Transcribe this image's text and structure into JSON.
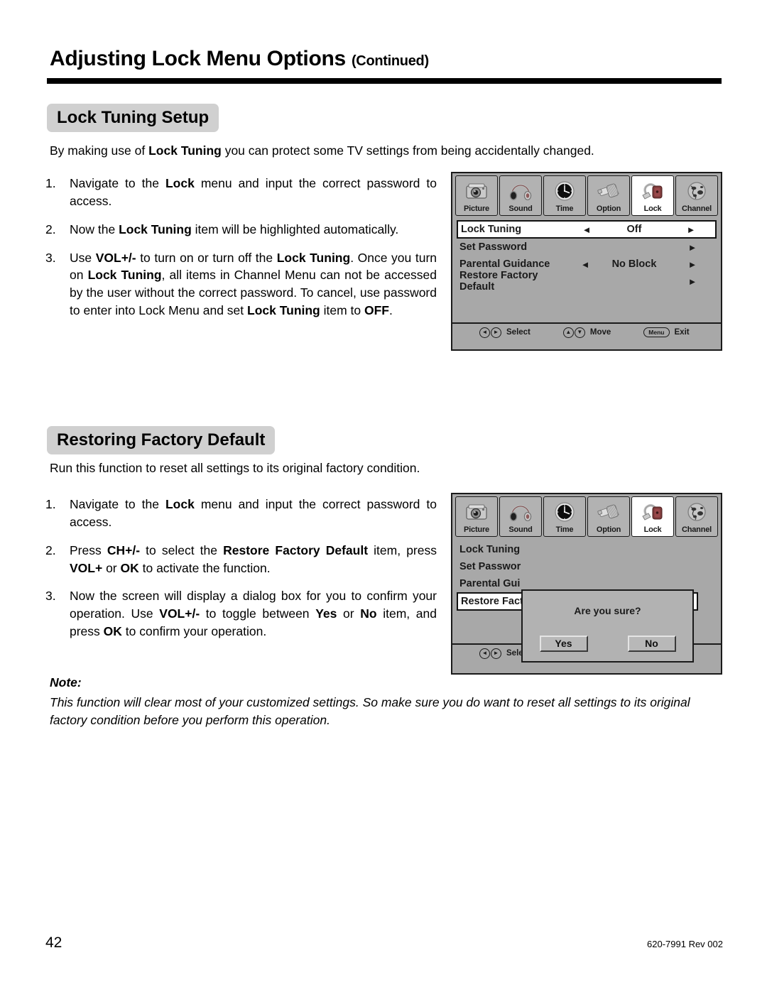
{
  "page": {
    "title_main": "Adjusting Lock Menu Options",
    "title_continued": "(Continued)",
    "folio": "42",
    "part_number": "620-7991 Rev 002"
  },
  "section_lock_tuning": {
    "heading": "Lock Tuning Setup",
    "intro_pre": "By making use of ",
    "intro_bold": "Lock Tuning",
    "intro_post": " you can protect some TV settings from being accidentally changed.",
    "steps": [
      {
        "num": "1.",
        "parts": [
          {
            "t": "Navigate to the ",
            "b": false
          },
          {
            "t": "Lock",
            "b": true
          },
          {
            "t": " menu and input the correct password to access.",
            "b": false
          }
        ]
      },
      {
        "num": "2.",
        "parts": [
          {
            "t": "Now the ",
            "b": false
          },
          {
            "t": "Lock Tuning",
            "b": true
          },
          {
            "t": " item will be highlighted automatically.",
            "b": false
          }
        ]
      },
      {
        "num": "3.",
        "parts": [
          {
            "t": "Use ",
            "b": false
          },
          {
            "t": "VOL+/-",
            "b": true
          },
          {
            "t": " to turn on or turn off the ",
            "b": false
          },
          {
            "t": "Lock Tuning",
            "b": true
          },
          {
            "t": ". Once you turn on ",
            "b": false
          },
          {
            "t": "Lock Tuning",
            "b": true
          },
          {
            "t": ", all items in Channel Menu can not be accessed by the user without the correct password. To cancel, use password to enter into Lock Menu and set ",
            "b": false
          },
          {
            "t": "Lock Tuning",
            "b": true
          },
          {
            "t": " item to ",
            "b": false
          },
          {
            "t": "OFF",
            "b": true
          },
          {
            "t": ".",
            "b": false
          }
        ]
      }
    ]
  },
  "section_restore": {
    "heading": "Restoring Factory Default",
    "intro": "Run this function to reset all settings to its original factory condition.",
    "steps": [
      {
        "num": "1.",
        "parts": [
          {
            "t": "Navigate to the ",
            "b": false
          },
          {
            "t": "Lock",
            "b": true
          },
          {
            "t": " menu and input the correct password to access.",
            "b": false
          }
        ]
      },
      {
        "num": "2.",
        "parts": [
          {
            "t": "Press ",
            "b": false
          },
          {
            "t": "CH+/-",
            "b": true
          },
          {
            "t": " to select the ",
            "b": false
          },
          {
            "t": "Restore Factory Default",
            "b": true
          },
          {
            "t": " item, press ",
            "b": false
          },
          {
            "t": "VOL+",
            "b": true
          },
          {
            "t": " or ",
            "b": false
          },
          {
            "t": "OK",
            "b": true
          },
          {
            "t": " to activate the function.",
            "b": false
          }
        ]
      },
      {
        "num": "3.",
        "parts": [
          {
            "t": "Now the screen will display a dialog box for you to confirm your operation. Use ",
            "b": false
          },
          {
            "t": "VOL+/-",
            "b": true
          },
          {
            "t": " to toggle between ",
            "b": false
          },
          {
            "t": "Yes",
            "b": true
          },
          {
            "t": " or ",
            "b": false
          },
          {
            "t": "No",
            "b": true
          },
          {
            "t": " item, and press ",
            "b": false
          },
          {
            "t": "OK",
            "b": true
          },
          {
            "t": " to confirm your operation.",
            "b": false
          }
        ]
      }
    ]
  },
  "note": {
    "label": "Note:",
    "text": "This function will clear most of your customized settings. So make sure you do want to reset all settings to its original factory condition before you perform this operation."
  },
  "osd": {
    "tabs": [
      {
        "label": "Picture",
        "icon": "camera-icon",
        "active": false
      },
      {
        "label": "Sound",
        "icon": "headphones-icon",
        "active": false
      },
      {
        "label": "Time",
        "icon": "clock-icon",
        "active": false
      },
      {
        "label": "Option",
        "icon": "connector-icon",
        "active": false
      },
      {
        "label": "Lock",
        "icon": "padlock-icon",
        "active": true
      },
      {
        "label": "Channel",
        "icon": "globe-icon",
        "active": false
      }
    ],
    "menu_rows": [
      {
        "label": "Lock Tuning",
        "left_arrow": "◄",
        "value": "Off",
        "right_arrow": "►",
        "selected": true
      },
      {
        "label": "Set Password",
        "left_arrow": "",
        "value": "",
        "right_arrow": "►",
        "selected": false
      },
      {
        "label": "Parental Guidance",
        "left_arrow": "◄",
        "value": "No Block",
        "right_arrow": "►",
        "selected": false
      },
      {
        "label": "Restore Factory Default",
        "left_arrow": "",
        "value": "",
        "right_arrow": "►",
        "selected": false
      }
    ],
    "menu_rows_dialog": [
      {
        "label": "Lock Tuning",
        "selected": false
      },
      {
        "label": "Set Passwor",
        "selected": false
      },
      {
        "label": "Parental Gui",
        "selected": false
      },
      {
        "label": "Restore Fact",
        "selected": true
      }
    ],
    "footer": {
      "select_label": "Select",
      "move_label": "Move",
      "exit_label": "Exit",
      "menu_key": "Menu",
      "left_glyph": "◄",
      "right_glyph": "►",
      "up_glyph": "▲",
      "down_glyph": "▼"
    },
    "dialog": {
      "message": "Are you sure?",
      "yes_label": "Yes",
      "no_label": "No"
    },
    "colors": {
      "panel_bg": "#a8a8a8",
      "tab_bg": "#b2b2b2",
      "tab_active_bg": "#ffffff",
      "border": "#1a1a1a",
      "selected_row_bg": "#ffffff"
    }
  }
}
